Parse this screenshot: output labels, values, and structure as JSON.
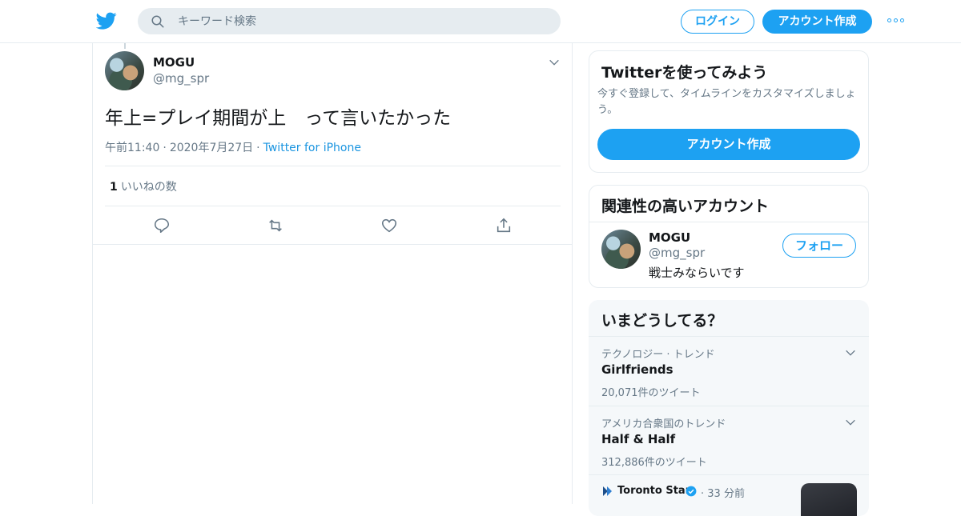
{
  "header": {
    "search_placeholder": "キーワード検索",
    "login_label": "ログイン",
    "signup_label": "アカウント作成"
  },
  "tweet": {
    "display_name": "MOGU",
    "handle": "@mg_spr",
    "text": "年上=プレイ期間が上　って言いたかった",
    "time": "午前11:40",
    "date": "2020年7月27日",
    "source": "Twitter for iPhone",
    "like_count": "1",
    "like_label": "いいねの数"
  },
  "sidebar": {
    "signup_card": {
      "title": "Twitterを使ってみよう",
      "description": "今すぐ登録して、タイムラインをカスタマイズしましょう。",
      "button_label": "アカウント作成"
    },
    "related": {
      "title": "関連性の高いアカウント",
      "account": {
        "name": "MOGU",
        "handle": "@mg_spr",
        "bio": "戦士みならいです",
        "follow_label": "フォロー"
      }
    },
    "trends": {
      "title": "いまどうしてる？",
      "items": [
        {
          "context": "テクノロジー · トレンド",
          "topic": "Girlfriends",
          "count": "20,071件のツイート"
        },
        {
          "context": "アメリカ合衆国のトレンド",
          "topic": "Half & Half",
          "count": "312,886件のツイート"
        }
      ],
      "news": {
        "source": "Toronto Star",
        "time": "· 33 分前"
      }
    }
  },
  "colors": {
    "accent": "#1da1f2",
    "text": "#14171a",
    "secondary": "#657786",
    "border": "#e6ecf0"
  }
}
